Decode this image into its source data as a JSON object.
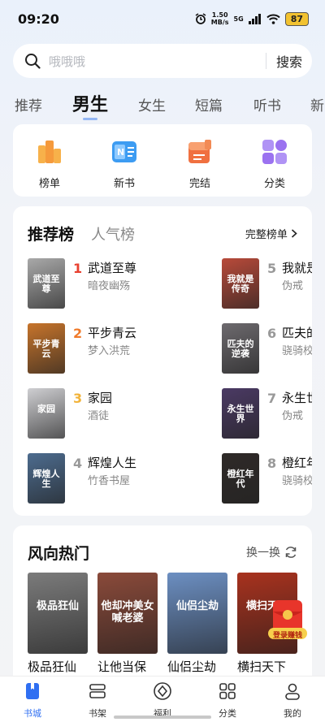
{
  "status_bar": {
    "time": "09:20",
    "speed_value": "1.50",
    "speed_unit": "MB/s",
    "network": "5G",
    "battery": "87"
  },
  "search": {
    "placeholder": "哦哦哦",
    "button": "搜索"
  },
  "tabs": [
    "推荐",
    "男生",
    "女生",
    "短篇",
    "听书",
    "新"
  ],
  "active_tab": "男生",
  "categories": [
    {
      "label": "榜单",
      "icon": "ranking-icon",
      "color": "#f59a3c"
    },
    {
      "label": "新书",
      "icon": "new-book-icon",
      "color": "#3d9cf2"
    },
    {
      "label": "完结",
      "icon": "finished-icon",
      "color": "#f07040"
    },
    {
      "label": "分类",
      "icon": "category-icon",
      "color": "#9b72f0"
    }
  ],
  "ranking": {
    "tab_active": "推荐榜",
    "tab_other": "人气榜",
    "more": "完整榜单",
    "books": [
      {
        "rank": "1",
        "title": "武道至尊",
        "author": "暗夜幽殇",
        "cover_text": "武道至尊",
        "rank_color": "#e8402f",
        "cover_color": "#a9a9a9"
      },
      {
        "rank": "2",
        "title": "平步青云",
        "author": "梦入洪荒",
        "cover_text": "平步青云",
        "rank_color": "#f07a2a",
        "cover_color": "#c7742b"
      },
      {
        "rank": "3",
        "title": "家园",
        "author": "酒徒",
        "cover_text": "家园",
        "rank_color": "#f2b33a",
        "cover_color": "#cfcfd2"
      },
      {
        "rank": "4",
        "title": "辉煌人生",
        "author": "竹香书屋",
        "cover_text": "辉煌人生",
        "rank_color": "#999999",
        "cover_color": "#4d6c8f"
      },
      {
        "rank": "5",
        "title": "我就是",
        "author": "伪戒",
        "cover_text": "我就是传奇",
        "rank_color": "#999999",
        "cover_color": "#b84a3a"
      },
      {
        "rank": "6",
        "title": "匹夫的",
        "author": "骁骑校",
        "cover_text": "匹夫的逆袭",
        "rank_color": "#999999",
        "cover_color": "#6d6a6e"
      },
      {
        "rank": "7",
        "title": "永生世",
        "author": "伪戒",
        "cover_text": "永生世界",
        "rank_color": "#999999",
        "cover_color": "#4b3a64"
      },
      {
        "rank": "8",
        "title": "橙红年",
        "author": "骁骑校",
        "cover_text": "橙红年代",
        "rank_color": "#999999",
        "cover_color": "#2f2a28"
      }
    ]
  },
  "hot": {
    "title": "风向热门",
    "refresh": "换一换",
    "books": [
      {
        "title": "极品狂仙",
        "cover_text": "极品狂仙",
        "cover_color": "#7b7b7b"
      },
      {
        "title": "让他当保镖，他...",
        "cover_text": "他却冲美女喊老婆",
        "cover_color": "#8a4a3a"
      },
      {
        "title": "仙侣尘劫",
        "cover_text": "仙侣尘劫",
        "cover_color": "#6c8fc2"
      },
      {
        "title": "横扫天下",
        "cover_text": "横扫天下",
        "cover_color": "#a8321e"
      }
    ],
    "red_packet": "登录赚钱"
  },
  "nav": [
    {
      "label": "书城",
      "icon": "bookstore-icon"
    },
    {
      "label": "书架",
      "icon": "bookshelf-icon"
    },
    {
      "label": "福利",
      "icon": "welfare-icon"
    },
    {
      "label": "分类",
      "icon": "category-grid-icon"
    },
    {
      "label": "我的",
      "icon": "profile-icon"
    }
  ],
  "colors": {
    "accent": "#2f6ff2",
    "rank1": "#e8402f",
    "rank2": "#f07a2a",
    "rank3": "#f2b33a"
  }
}
